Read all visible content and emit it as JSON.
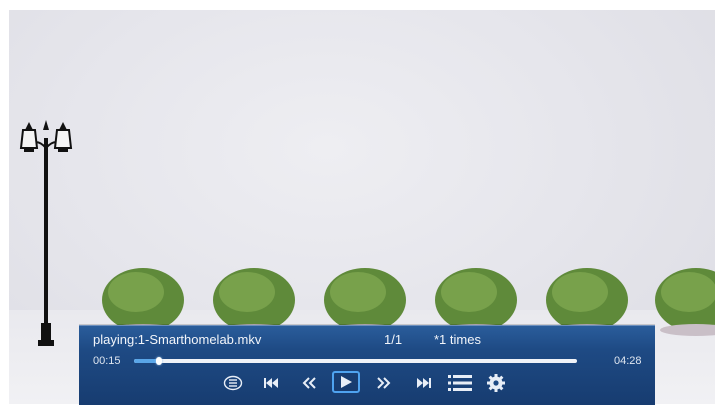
{
  "player": {
    "now_playing": "playing:1-Smarthomelab.mkv",
    "track_index": "1/1",
    "repeat_count": "*1 times",
    "elapsed": "00:15",
    "duration": "04:28",
    "progress_fraction": 0.056
  },
  "controls": [
    {
      "name": "repeat-mode-button",
      "icon": "repeat-list-icon"
    },
    {
      "name": "previous-button",
      "icon": "skip-previous-icon"
    },
    {
      "name": "rewind-button",
      "icon": "rewind-icon"
    },
    {
      "name": "play-button",
      "icon": "play-icon",
      "selected": true
    },
    {
      "name": "fast-forward-button",
      "icon": "fast-forward-icon"
    },
    {
      "name": "next-button",
      "icon": "skip-next-icon"
    },
    {
      "name": "playlist-button",
      "icon": "list-icon"
    },
    {
      "name": "settings-button",
      "icon": "gear-icon"
    }
  ],
  "colors": {
    "panel": "#1e4a84",
    "progress_fill": "#5aa6e8",
    "focus_border": "#4fa3f0"
  }
}
